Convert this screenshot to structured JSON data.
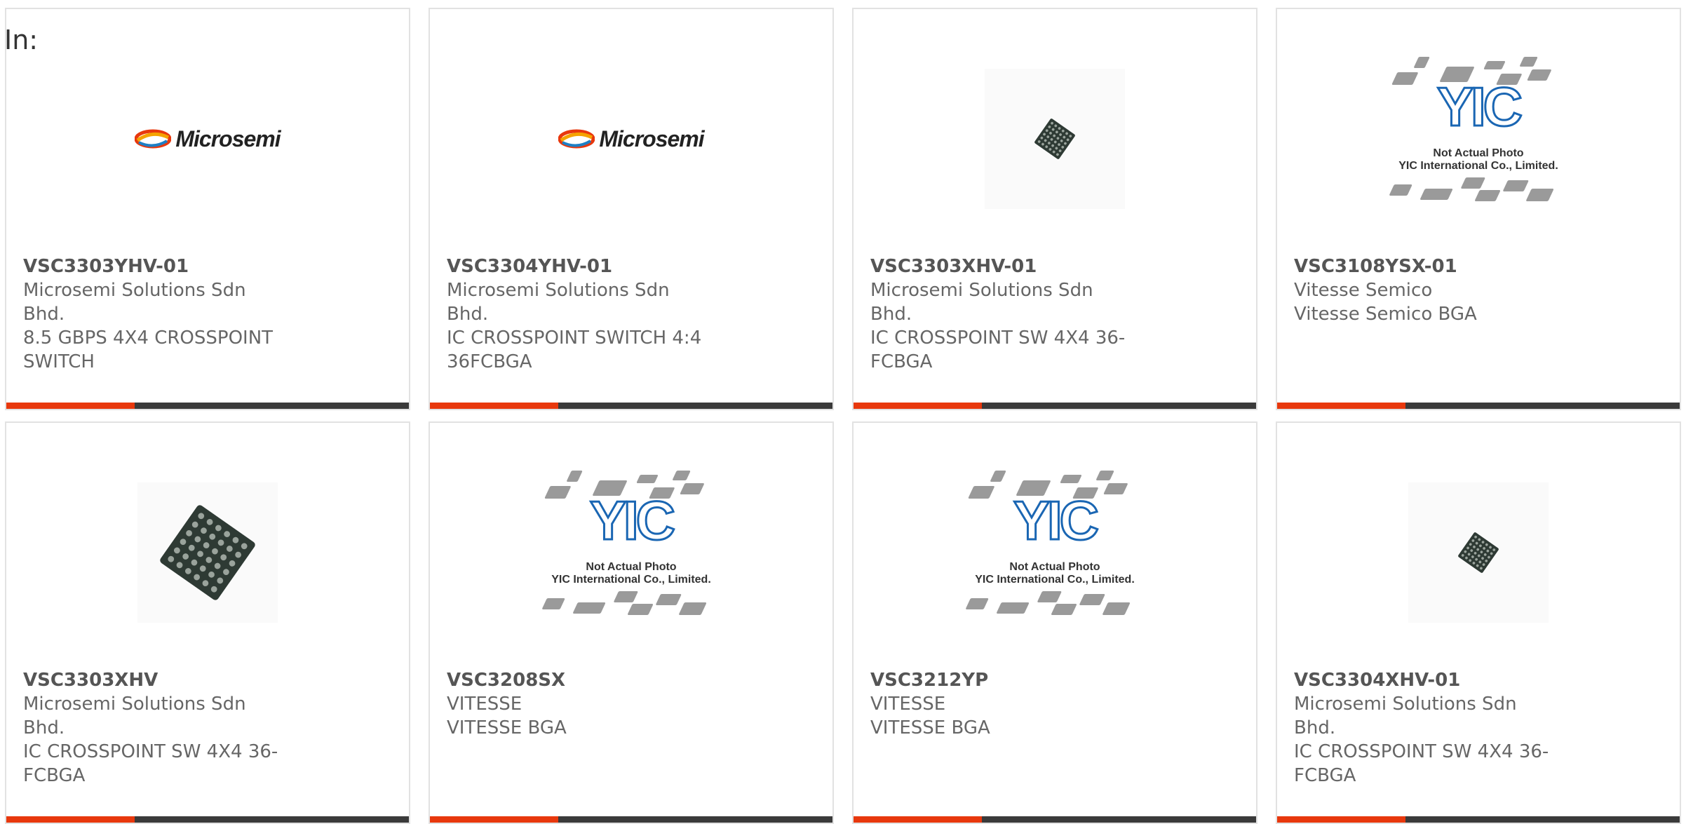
{
  "header": {
    "label": "In:"
  },
  "colors": {
    "accent": "#e8380d",
    "bar": "#3a3a3a",
    "card_border": "#e2e2e2"
  },
  "placeholder": {
    "logo_text": "YIC",
    "line1": "Not Actual Photo",
    "line2": "YIC International Co., Limited."
  },
  "brand": {
    "microsemi": "Microsemi"
  },
  "products": [
    {
      "part": "VSC3303YHV-01",
      "manufacturer": "Microsemi Solutions Sdn Bhd.",
      "description": "8.5 GBPS 4X4 CROSSPOINT SWITCH",
      "image": "microsemi-logo"
    },
    {
      "part": "VSC3304YHV-01",
      "manufacturer": "Microsemi Solutions Sdn Bhd.",
      "description": "IC CROSSPOINT SWITCH 4:4 36FCBGA",
      "image": "microsemi-logo"
    },
    {
      "part": "VSC3303XHV-01",
      "manufacturer": "Microsemi Solutions Sdn Bhd.",
      "description": "IC CROSSPOINT SW 4X4 36-FCBGA",
      "image": "chip-small"
    },
    {
      "part": "VSC3108YSX-01",
      "manufacturer": "Vitesse Semico",
      "description": "Vitesse Semico BGA",
      "image": "yic-placeholder"
    },
    {
      "part": "VSC3303XHV",
      "manufacturer": "Microsemi Solutions Sdn Bhd.",
      "description": "IC CROSSPOINT SW 4X4 36-FCBGA",
      "image": "chip-large"
    },
    {
      "part": "VSC3208SX",
      "manufacturer": "VITESSE",
      "description": "VITESSE BGA",
      "image": "yic-placeholder"
    },
    {
      "part": "VSC3212YP",
      "manufacturer": "VITESSE",
      "description": "VITESSE BGA",
      "image": "yic-placeholder"
    },
    {
      "part": "VSC3304XHV-01",
      "manufacturer": "Microsemi Solutions Sdn Bhd.",
      "description": "IC CROSSPOINT SW 4X4 36-FCBGA",
      "image": "chip-small"
    }
  ]
}
